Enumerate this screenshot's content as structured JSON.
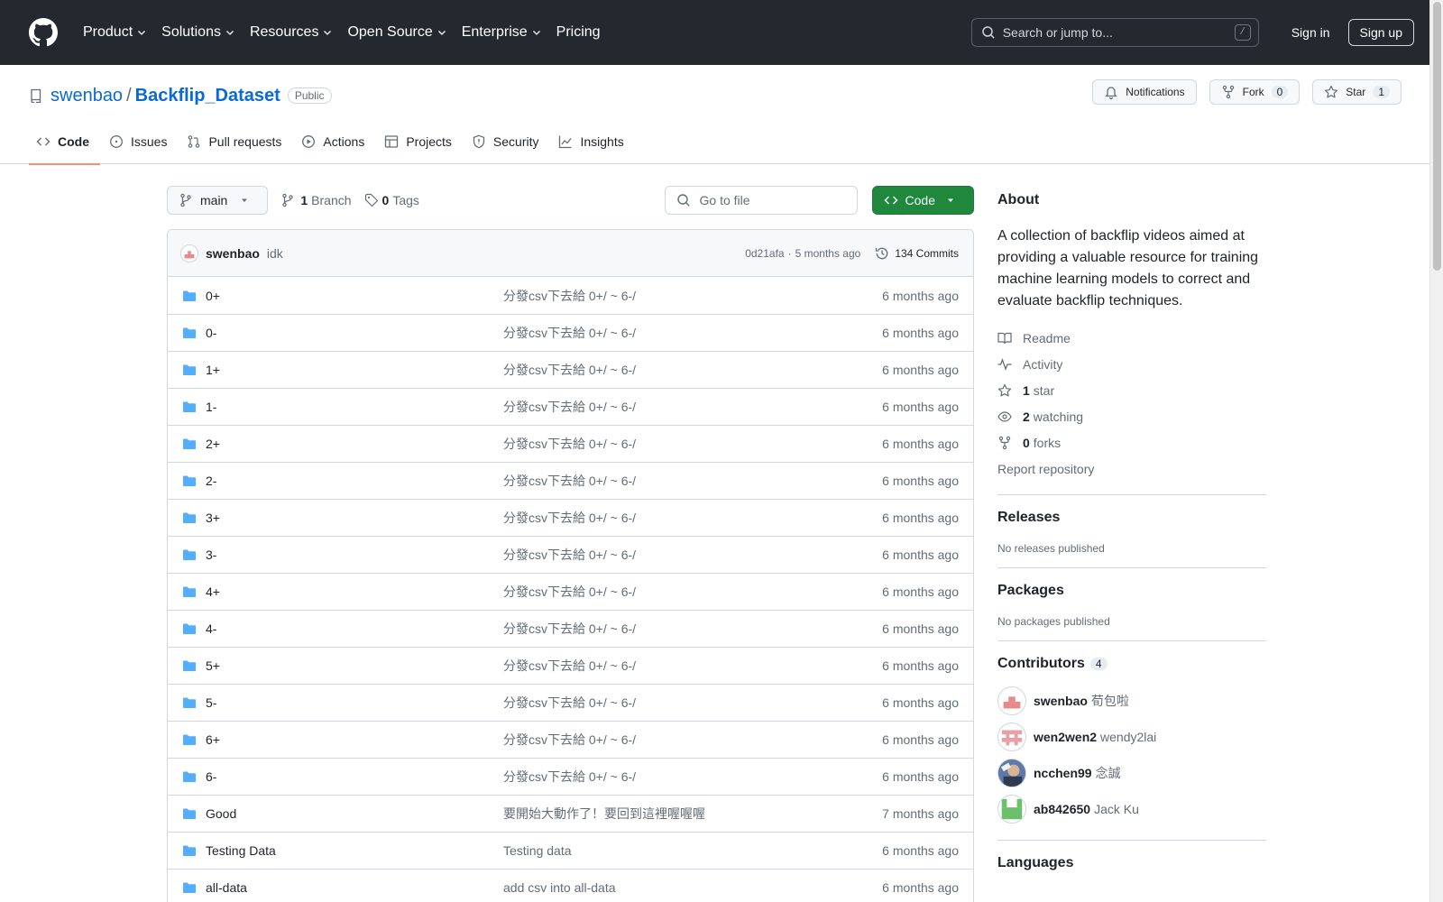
{
  "header": {
    "nav": [
      {
        "label": "Product",
        "dropdown": true
      },
      {
        "label": "Solutions",
        "dropdown": true
      },
      {
        "label": "Resources",
        "dropdown": true
      },
      {
        "label": "Open Source",
        "dropdown": true
      },
      {
        "label": "Enterprise",
        "dropdown": true
      },
      {
        "label": "Pricing",
        "dropdown": false
      }
    ],
    "search_placeholder": "Search or jump to...",
    "search_key": "/",
    "signin": "Sign in",
    "signup": "Sign up"
  },
  "repo": {
    "owner": "swenbao",
    "separator": "/",
    "name": "Backflip_Dataset",
    "visibility": "Public",
    "notifications_label": "Notifications",
    "fork_label": "Fork",
    "fork_count": "0",
    "star_label": "Star",
    "star_count": "1"
  },
  "tabs": [
    {
      "label": "Code",
      "icon": "code-icon",
      "active": true
    },
    {
      "label": "Issues",
      "icon": "issue-icon",
      "active": false
    },
    {
      "label": "Pull requests",
      "icon": "pull-request-icon",
      "active": false
    },
    {
      "label": "Actions",
      "icon": "play-icon",
      "active": false
    },
    {
      "label": "Projects",
      "icon": "table-icon",
      "active": false
    },
    {
      "label": "Security",
      "icon": "shield-icon",
      "active": false
    },
    {
      "label": "Insights",
      "icon": "graph-icon",
      "active": false
    }
  ],
  "toolbar": {
    "branch": "main",
    "branch_count": "1",
    "branch_label": "Branch",
    "tag_count": "0",
    "tag_label": "Tags",
    "goto_placeholder": "Go to file",
    "code_label": "Code"
  },
  "commit": {
    "author": "swenbao",
    "message": "idk",
    "hash": "0d21afa",
    "separator": "·",
    "time": "5 months ago",
    "commits_label": "134 Commits"
  },
  "files": [
    {
      "name": "0+",
      "message": "分發csv下去給 0+/ ~ 6-/",
      "date": "6 months ago"
    },
    {
      "name": "0-",
      "message": "分發csv下去給 0+/ ~ 6-/",
      "date": "6 months ago"
    },
    {
      "name": "1+",
      "message": "分發csv下去給 0+/ ~ 6-/",
      "date": "6 months ago"
    },
    {
      "name": "1-",
      "message": "分發csv下去給 0+/ ~ 6-/",
      "date": "6 months ago"
    },
    {
      "name": "2+",
      "message": "分發csv下去給 0+/ ~ 6-/",
      "date": "6 months ago"
    },
    {
      "name": "2-",
      "message": "分發csv下去給 0+/ ~ 6-/",
      "date": "6 months ago"
    },
    {
      "name": "3+",
      "message": "分發csv下去給 0+/ ~ 6-/",
      "date": "6 months ago"
    },
    {
      "name": "3-",
      "message": "分發csv下去給 0+/ ~ 6-/",
      "date": "6 months ago"
    },
    {
      "name": "4+",
      "message": "分發csv下去給 0+/ ~ 6-/",
      "date": "6 months ago"
    },
    {
      "name": "4-",
      "message": "分發csv下去給 0+/ ~ 6-/",
      "date": "6 months ago"
    },
    {
      "name": "5+",
      "message": "分發csv下去給 0+/ ~ 6-/",
      "date": "6 months ago"
    },
    {
      "name": "5-",
      "message": "分發csv下去給 0+/ ~ 6-/",
      "date": "6 months ago"
    },
    {
      "name": "6+",
      "message": "分發csv下去給 0+/ ~ 6-/",
      "date": "6 months ago"
    },
    {
      "name": "6-",
      "message": "分發csv下去給 0+/ ~ 6-/",
      "date": "6 months ago"
    },
    {
      "name": "Good",
      "message": "要開始大動作了！要回到這裡喔喔喔",
      "date": "7 months ago"
    },
    {
      "name": "Testing Data",
      "message": "Testing data",
      "date": "6 months ago"
    },
    {
      "name": "all-data",
      "message": "add csv into all-data",
      "date": "6 months ago"
    }
  ],
  "about": {
    "title": "About",
    "description": "A collection of backflip videos aimed at providing a valuable resource for training machine learning models to correct and evaluate backflip techniques.",
    "readme": "Readme",
    "activity": "Activity",
    "stars_count": "1",
    "stars_label": "star",
    "watching_count": "2",
    "watching_label": "watching",
    "forks_count": "0",
    "forks_label": "forks",
    "report": "Report repository"
  },
  "releases": {
    "title": "Releases",
    "empty": "No releases published"
  },
  "packages": {
    "title": "Packages",
    "empty": "No packages published"
  },
  "contributors": {
    "title": "Contributors",
    "count": "4",
    "list": [
      {
        "login": "swenbao",
        "name": "荀包啦"
      },
      {
        "login": "wen2wen2",
        "name": "wendy2lai"
      },
      {
        "login": "ncchen99",
        "name": "念誠"
      },
      {
        "login": "ab842650",
        "name": "Jack Ku"
      }
    ]
  },
  "languages": {
    "title": "Languages"
  },
  "colors": {
    "header_bg": "#24292f",
    "link": "#0969da",
    "code_button": "#1f883d",
    "active_tab": "#fd8c73",
    "folder": "#54aeff"
  }
}
